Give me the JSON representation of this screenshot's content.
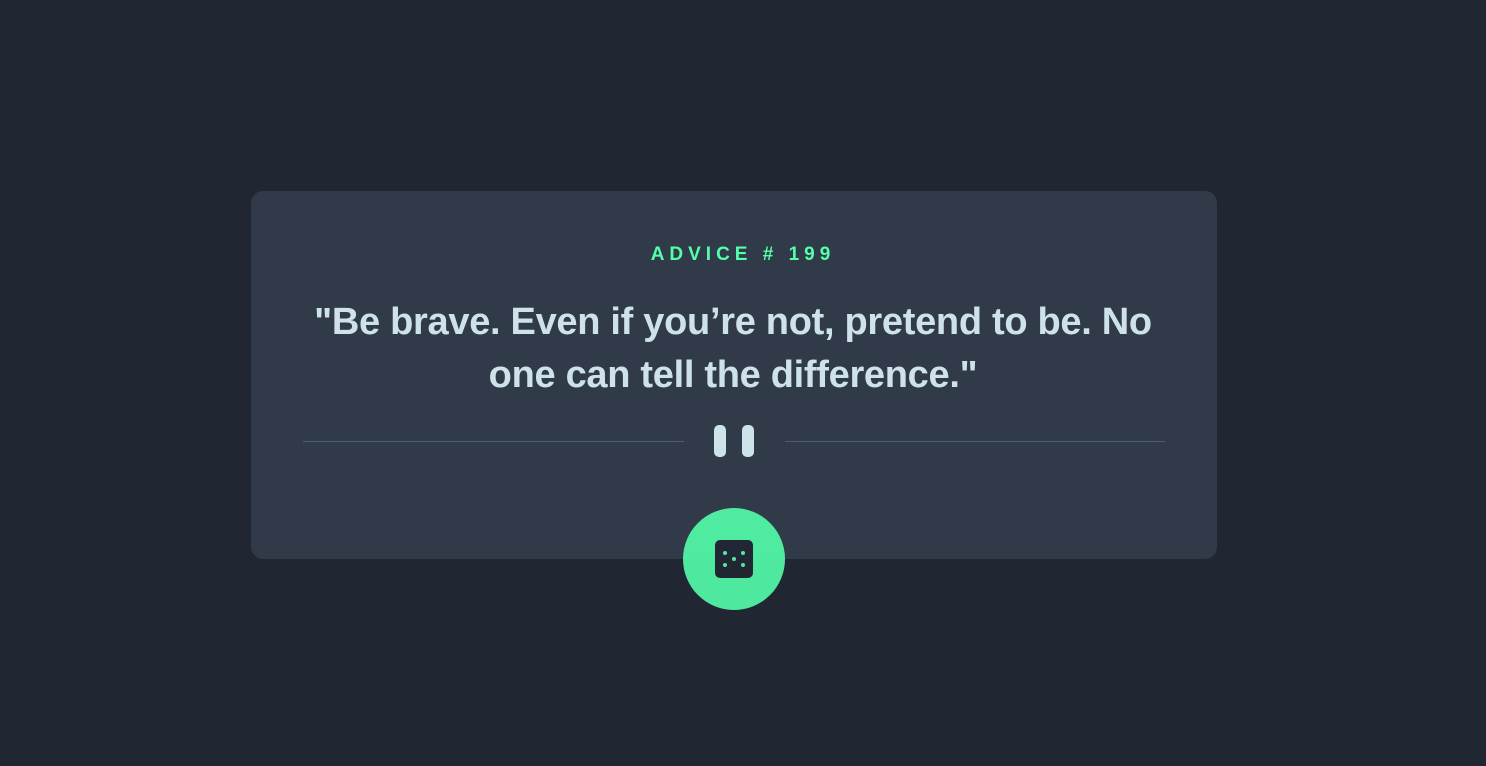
{
  "advice": {
    "id_label": "ADVICE # 199",
    "quote": "\"Be brave. Even if you’re not, pretend to be. No one can tell the difference.\""
  },
  "icons": {
    "divider": "pause-icon",
    "button": "dice-icon"
  },
  "colors": {
    "background": "#202632",
    "card": "#313a48",
    "accent": "#53ffab",
    "text": "#cee3e9",
    "divider": "#4f5d74"
  }
}
